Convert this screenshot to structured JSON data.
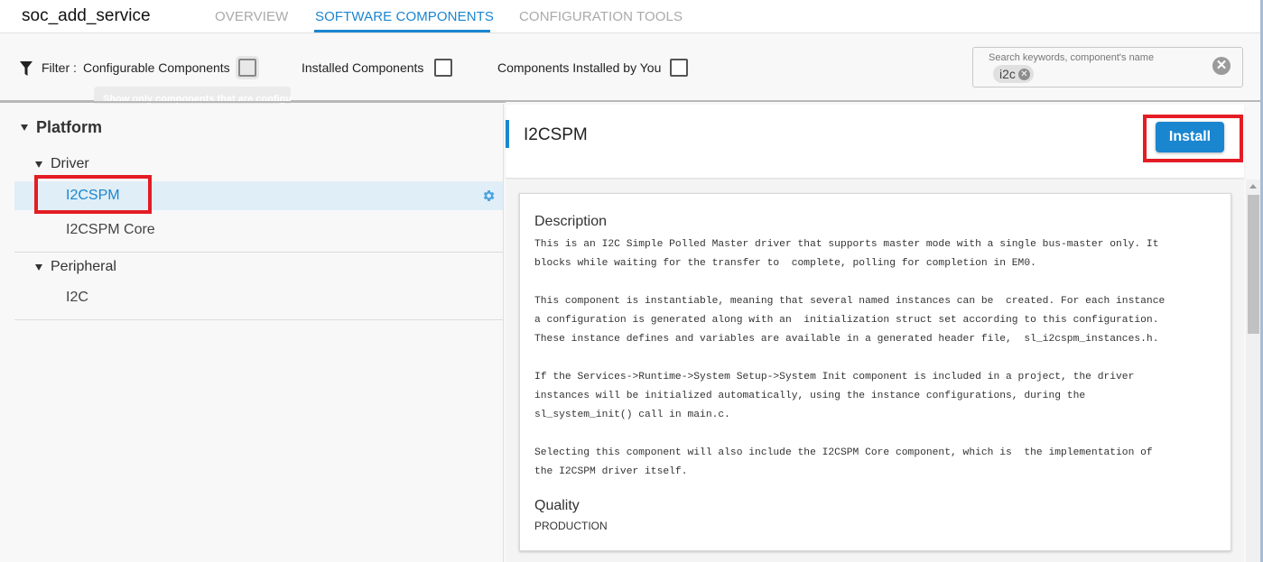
{
  "header": {
    "project_title": "soc_add_service",
    "tabs": [
      {
        "label": "OVERVIEW",
        "active": false
      },
      {
        "label": "SOFTWARE COMPONENTS",
        "active": true
      },
      {
        "label": "CONFIGURATION TOOLS",
        "active": false
      }
    ]
  },
  "filter": {
    "label": "Filter :",
    "options": [
      {
        "label": "Configurable Components",
        "checked": false
      },
      {
        "label": "Installed Components",
        "checked": false
      },
      {
        "label": "Components Installed by You",
        "checked": false
      }
    ],
    "tooltip": "Show only components that are configurable"
  },
  "search": {
    "placeholder": "Search keywords, component's name",
    "chips": [
      "i2c"
    ]
  },
  "tree": {
    "root": "Platform",
    "categories": [
      {
        "label": "Driver",
        "items": [
          "I2CSPM",
          "I2CSPM Core"
        ]
      },
      {
        "label": "Peripheral",
        "items": [
          "I2C"
        ]
      }
    ],
    "selected": "I2CSPM"
  },
  "detail": {
    "title": "I2CSPM",
    "install_label": "Install",
    "description_title": "Description",
    "description": [
      "This is an I2C Simple Polled Master driver that supports master mode with a single bus-master only. It\nblocks while waiting for the transfer to  complete, polling for completion in EM0.",
      "This component is instantiable, meaning that several named instances can be  created. For each instance\na configuration is generated along with an  initialization struct set according to this configuration.\nThese instance defines and variables are available in a generated header file,  sl_i2cspm_instances.h.",
      "If the Services->Runtime->System Setup->System Init component is included in a project, the driver\ninstances will be initialized automatically, using the instance configurations, during the\nsl_system_init() call in main.c.",
      "Selecting this component will also include the I2CSPM Core component, which is  the implementation of\nthe I2CSPM driver itself."
    ],
    "quality_title": "Quality",
    "quality_value": "PRODUCTION"
  },
  "colors": {
    "accent": "#1a86d0",
    "highlight_box": "#e41c24",
    "selected_row": "#e0eef7"
  }
}
